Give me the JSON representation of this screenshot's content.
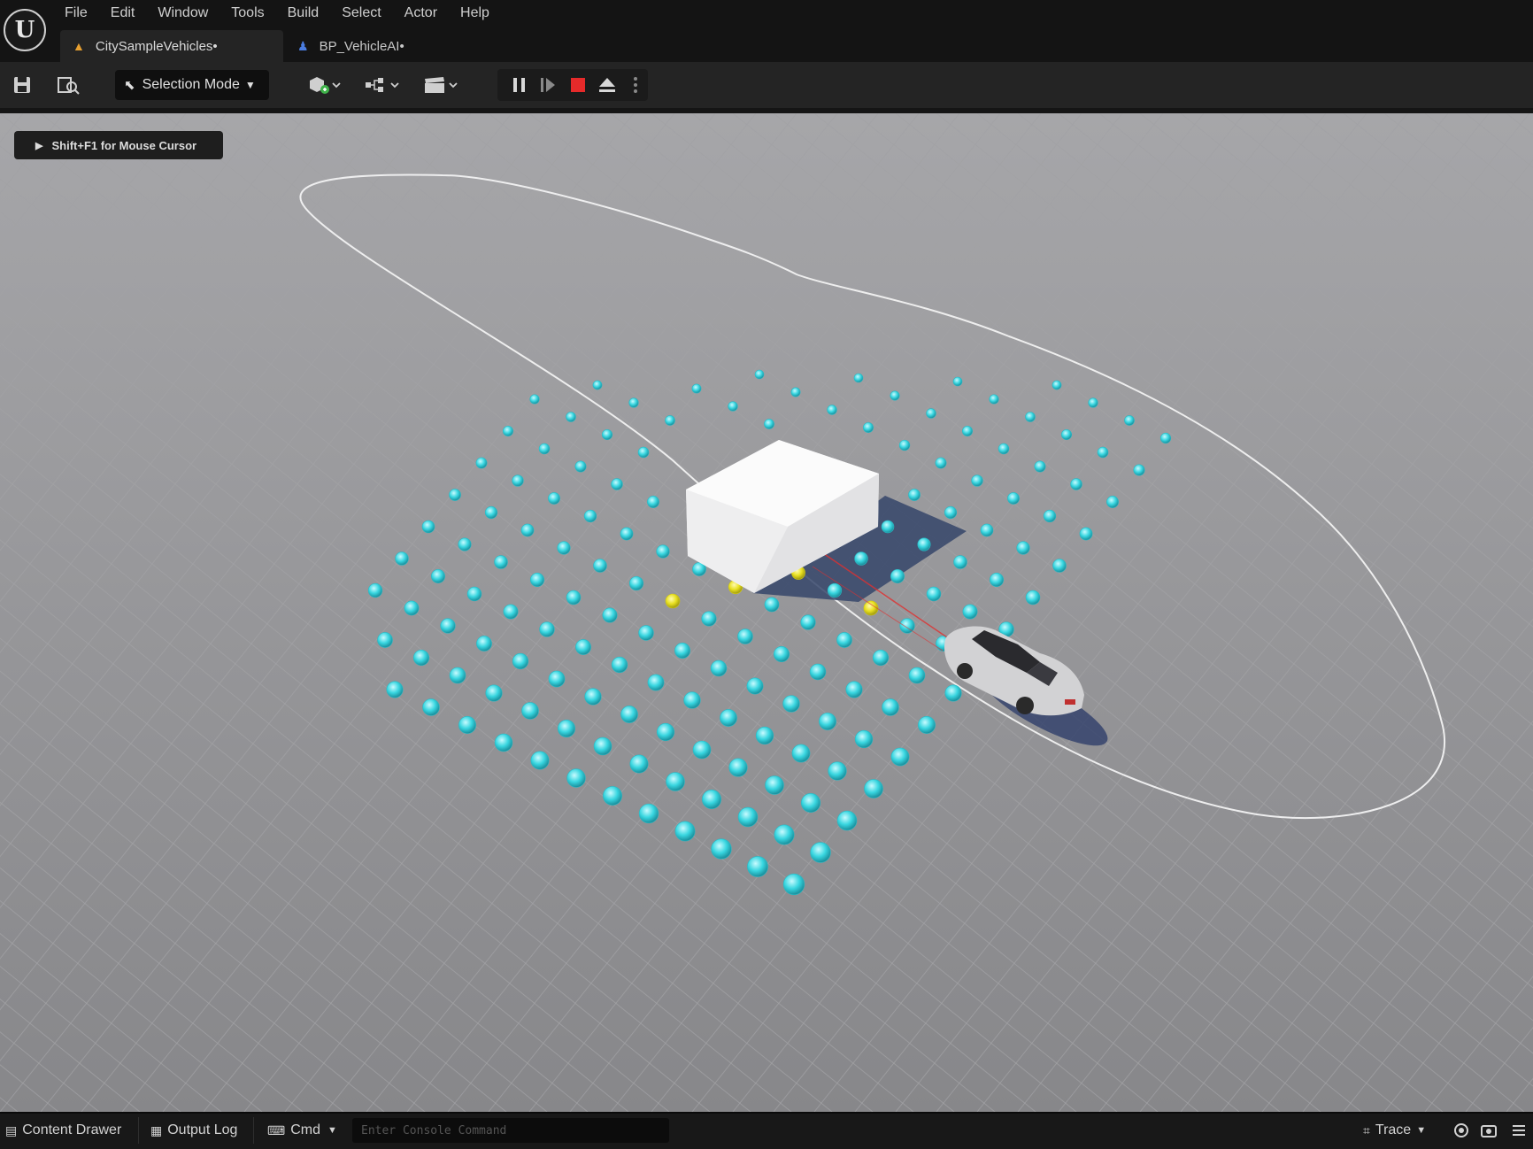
{
  "app": {
    "logo_letter": "U",
    "menu": [
      "File",
      "Edit",
      "Window",
      "Tools",
      "Build",
      "Select",
      "Actor",
      "Help"
    ]
  },
  "tabs": [
    {
      "label": "CitySampleVehicles•",
      "icon": "level-icon",
      "active": true
    },
    {
      "label": "BP_VehicleAI•",
      "icon": "blueprint-icon",
      "active": false
    }
  ],
  "toolbar": {
    "selection_mode": "Selection Mode",
    "icons": [
      "save-icon",
      "browse-icon",
      "add-actor-icon",
      "blueprint-flow-icon",
      "cinematics-icon",
      "pause-icon",
      "step-icon",
      "stop-icon",
      "eject-icon",
      "more-icon"
    ],
    "colors": {
      "stop": "#e62a2a"
    }
  },
  "viewport": {
    "hint": "Shift+F1 for Mouse Cursor",
    "colors": {
      "ground": "#8d8d90",
      "grid": "#a4a4a6",
      "spheres": "#38d6e0",
      "spheres_highlighted": "#e8e020",
      "box": "#f0f0f0",
      "spline": "#f2f2f2",
      "trace_line": "#e03030"
    }
  },
  "statusbar": {
    "content_drawer": "Content Drawer",
    "output_log": "Output Log",
    "cmd": "Cmd",
    "console_placeholder": "Enter Console Command",
    "trace": "Trace"
  }
}
